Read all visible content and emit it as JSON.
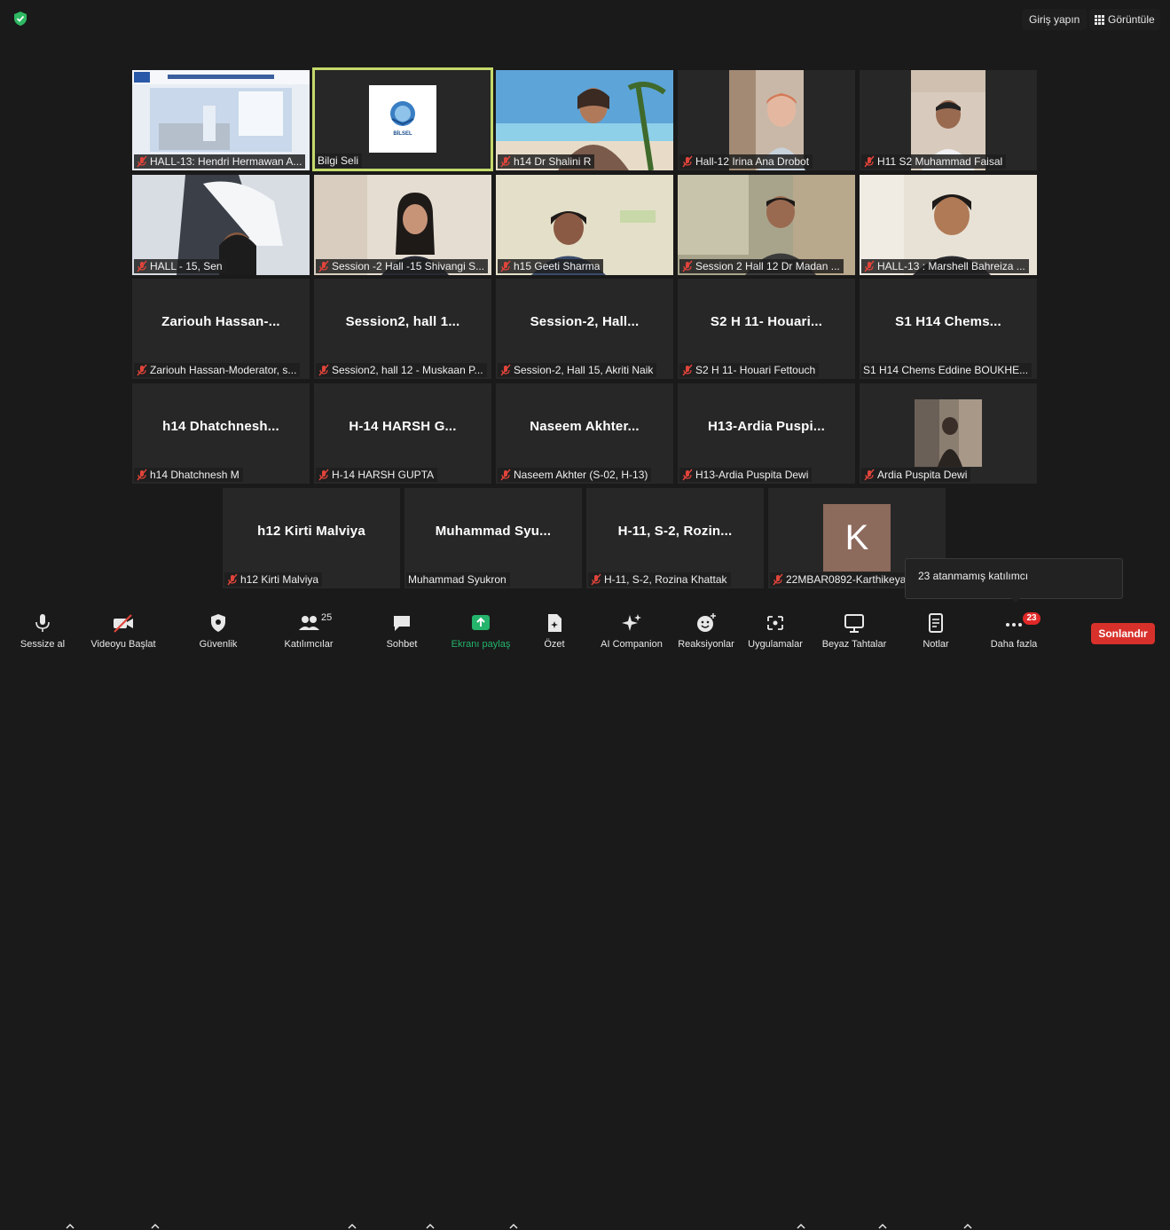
{
  "topbar": {
    "signin_label": "Giriş yapın",
    "view_label": "Görüntüle"
  },
  "tiles": [
    {
      "label": "HALL-13: Hendri Hermawan A...",
      "center": "",
      "muted": true
    },
    {
      "label": "Bilgi Seli",
      "center": "",
      "muted": false
    },
    {
      "label": "h14 Dr Shalini R",
      "center": "",
      "muted": true
    },
    {
      "label": "Hall-12 Irina Ana Drobot",
      "center": "",
      "muted": true
    },
    {
      "label": "H11 S2 Muhammad Faisal",
      "center": "",
      "muted": true
    },
    {
      "label": "HALL - 15, Sen",
      "center": "",
      "muted": true
    },
    {
      "label": "Session -2 Hall -15 Shivangi S...",
      "center": "",
      "muted": true
    },
    {
      "label": "h15 Geeti Sharma",
      "center": "",
      "muted": true
    },
    {
      "label": "Session 2 Hall 12 Dr Madan ...",
      "center": "",
      "muted": true
    },
    {
      "label": "HALL-13 : Marshell Bahreiza ...",
      "center": "",
      "muted": true
    },
    {
      "label": "Zariouh Hassan-Moderator, s...",
      "center": "Zariouh  Hassan-...",
      "muted": true
    },
    {
      "label": "Session2, hall 12 - Muskaan P...",
      "center": "Session2,  hall  1...",
      "muted": true
    },
    {
      "label": "Session-2, Hall 15, Akriti Naik",
      "center": "Session-2,  Hall...",
      "muted": true
    },
    {
      "label": "S2 H 11- Houari Fettouch",
      "center": "S2  H  11-  Houari...",
      "muted": true
    },
    {
      "label": "S1 H14  Chems Eddine BOUKHE...",
      "center": "S1  H14   Chems...",
      "muted": false
    },
    {
      "label": "h14 Dhatchnesh M",
      "center": "h14  Dhatchnesh...",
      "muted": true
    },
    {
      "label": "H-14 HARSH GUPTA",
      "center": "H-14  HARSH  G...",
      "muted": true
    },
    {
      "label": "Naseem Akhter (S-02, H-13)",
      "center": "Naseem  Akhter...",
      "muted": true
    },
    {
      "label": "H13-Ardia Puspita Dewi",
      "center": "H13-Ardia  Puspi...",
      "muted": true
    },
    {
      "label": "Ardia Puspita Dewi",
      "center": "",
      "muted": true
    },
    {
      "label": "h12 Kirti Malviya",
      "center": "h12  Kirti  Malviya",
      "muted": true
    },
    {
      "label": "Muhammad Syukron",
      "center": "Muhammad  Syu...",
      "muted": false
    },
    {
      "label": "H-11, S-2, Rozina Khattak",
      "center": "H-11,  S-2,  Rozin...",
      "muted": true
    },
    {
      "label": "22MBAR0892-Karthikeya",
      "center": "",
      "muted": true
    }
  ],
  "bilgi_logo_text": "BİLSEL",
  "avatar_letter": "K",
  "tooltip_text": "23 atanmamış katılımcı",
  "toolbar": {
    "mute": "Sessize al",
    "video": "Videoyu Başlat",
    "security": "Güvenlik",
    "participants": "Katılımcılar",
    "participants_count": "25",
    "chat": "Sohbet",
    "share": "Ekranı paylaş",
    "summary": "Özet",
    "ai": "AI Companion",
    "reactions": "Reaksiyonlar",
    "apps": "Uygulamalar",
    "whiteboards": "Beyaz Tahtalar",
    "notes": "Notlar",
    "more": "Daha fazla",
    "more_badge": "23",
    "end": "Sonlandır"
  },
  "colors": {
    "share_green": "#24b46c",
    "end_red": "#d8312c",
    "active_border": "#c4d96b",
    "mic_off_red": "#e0443a"
  }
}
